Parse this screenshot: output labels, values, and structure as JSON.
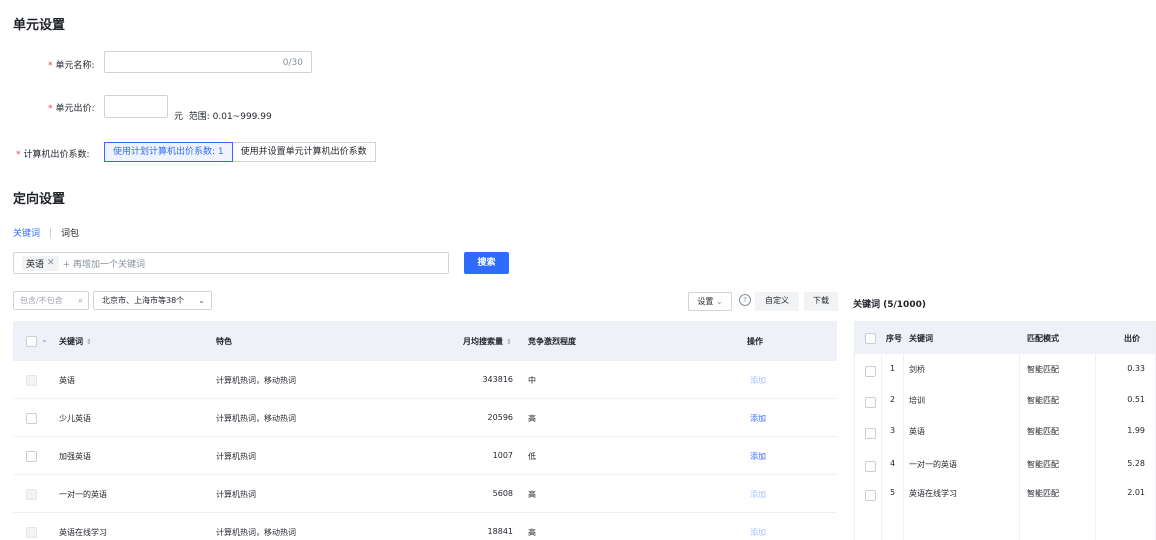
{
  "unit_settings": {
    "title": "单元设置",
    "name_label": "单元名称:",
    "name_value": "",
    "name_counter": "0/30",
    "bid_label": "单元出价:",
    "bid_value": "",
    "bid_unit": "元",
    "bid_range": "范围: 0.01~999.99",
    "coef_label": "计算机出价系数:",
    "coef_options": [
      "使用计划计算机出价系数: 1",
      "使用并设置单元计算机出价系数"
    ],
    "coef_selected": 0
  },
  "targeting": {
    "title": "定向设置",
    "tabs": [
      "关键词",
      "词包"
    ],
    "active_tab": 0,
    "search_chip": "英语",
    "search_placeholder": "+ 再增加一个关键词",
    "search_button": "搜索",
    "filter_placeholder": "包含/不包含",
    "region_select": "北京市、上海市等38个",
    "settings_button": "设置",
    "custom_button": "自定义",
    "download_button": "下载",
    "table": {
      "headers": {
        "keyword": "关键词",
        "feature": "特色",
        "monthly_search": "月均搜索量",
        "competition": "竞争激烈程度",
        "action": "操作"
      },
      "rows": [
        {
          "keyword": "英语",
          "feature": "计算机热词，移动热词",
          "monthly_search": "343816",
          "competition": "中",
          "action": "添加",
          "added": true
        },
        {
          "keyword": "少儿英语",
          "feature": "计算机热词，移动热词",
          "monthly_search": "20596",
          "competition": "高",
          "action": "添加",
          "added": false
        },
        {
          "keyword": "加强英语",
          "feature": "计算机热词",
          "monthly_search": "1007",
          "competition": "低",
          "action": "添加",
          "added": false
        },
        {
          "keyword": "一对一的英语",
          "feature": "计算机热词",
          "monthly_search": "5608",
          "competition": "高",
          "action": "添加",
          "added": true
        },
        {
          "keyword": "英语在线学习",
          "feature": "计算机热词，移动热词",
          "monthly_search": "18841",
          "competition": "高",
          "action": "添加",
          "added": true
        }
      ]
    }
  },
  "selected_keywords": {
    "title": "关键词 (5/1000)",
    "headers": {
      "index": "序号",
      "keyword": "关键词",
      "match": "匹配模式",
      "bid": "出价"
    },
    "rows": [
      {
        "index": "1",
        "keyword": "剑桥",
        "match": "智能匹配",
        "bid": "0.33"
      },
      {
        "index": "2",
        "keyword": "培训",
        "match": "智能匹配",
        "bid": "0.51"
      },
      {
        "index": "3",
        "keyword": "英语",
        "match": "智能匹配",
        "bid": "1.99"
      },
      {
        "index": "4",
        "keyword": "一对一的英语",
        "match": "智能匹配",
        "bid": "5.28"
      },
      {
        "index": "5",
        "keyword": "英语在线学习",
        "match": "智能匹配",
        "bid": "2.01"
      }
    ]
  },
  "colors": {
    "primary": "#2f6bff",
    "required": "#f53f3f",
    "header_bg": "#eef1f8"
  }
}
